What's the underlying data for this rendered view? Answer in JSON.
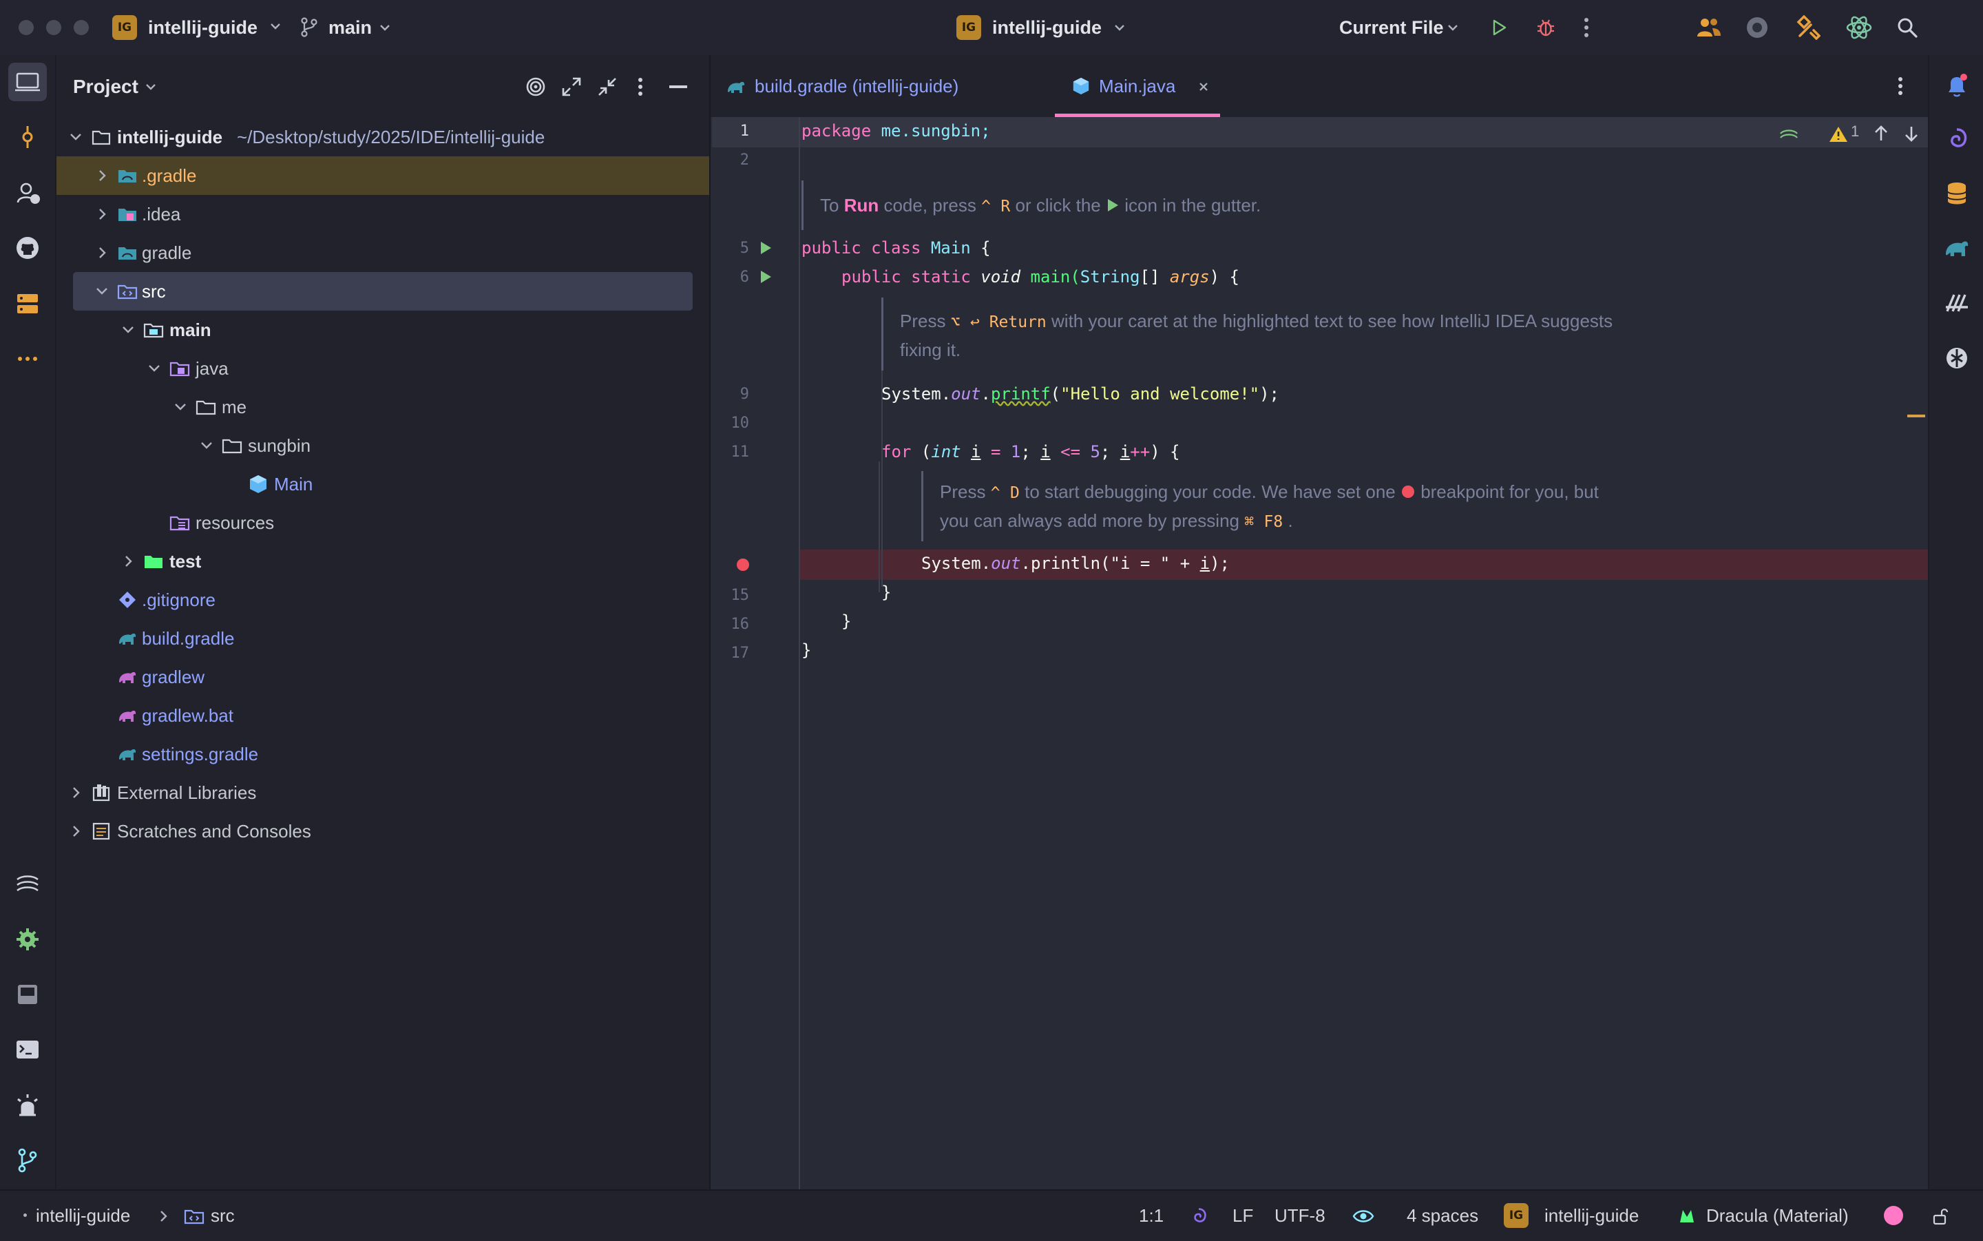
{
  "titlebar": {
    "project_badge": "IG",
    "project_name": "intellij-guide",
    "branch": "main",
    "center_project": "intellij-guide",
    "run_config": "Current File"
  },
  "project_panel": {
    "title": "Project",
    "tree": [
      {
        "label": "intellij-guide",
        "path": "~/Desktop/study/2025/IDE/intellij-guide"
      },
      {
        "label": ".gradle"
      },
      {
        "label": ".idea"
      },
      {
        "label": "gradle"
      },
      {
        "label": "src"
      },
      {
        "label": "main"
      },
      {
        "label": "java"
      },
      {
        "label": "me"
      },
      {
        "label": "sungbin"
      },
      {
        "label": "Main"
      },
      {
        "label": "resources"
      },
      {
        "label": "test"
      },
      {
        "label": ".gitignore"
      },
      {
        "label": "build.gradle"
      },
      {
        "label": "gradlew"
      },
      {
        "label": "gradlew.bat"
      },
      {
        "label": "settings.gradle"
      },
      {
        "label": "External Libraries"
      },
      {
        "label": "Scratches and Consoles"
      }
    ]
  },
  "tabs": [
    {
      "label": "build.gradle (intellij-guide)"
    },
    {
      "label": "Main.java"
    }
  ],
  "editor": {
    "line_numbers": [
      "1",
      "2",
      "5",
      "6",
      "9",
      "10",
      "11",
      "15",
      "16",
      "17"
    ],
    "warning_count": "1",
    "code": {
      "l1_kw": "package",
      "l1_rest": " me.sungbin;",
      "l5_a": "public class ",
      "l5_b": "Main",
      "l5_c": " {",
      "l6_a": "public static ",
      "l6_b": "void ",
      "l6_c": "main(",
      "l6_d": "String",
      "l6_e": "[] ",
      "l6_f": "args",
      "l6_g": ") {",
      "l9_a": "System.",
      "l9_b": "out",
      "l9_c": ".",
      "l9_d": "printf",
      "l9_e": "(",
      "l9_f": "\"Hello and welcome!\"",
      "l9_g": ");",
      "l11_a": "for ",
      "l11_b": "(",
      "l11_c": "int ",
      "l11_d": "i",
      "l11_e": " = ",
      "l11_f": "1",
      "l11_g": "; ",
      "l11_h": "i",
      "l11_i": " <= ",
      "l11_j": "5",
      "l11_k": "; ",
      "l11_l": "i",
      "l11_m": "++",
      "l11_n": ") {",
      "l13_a": "System.",
      "l13_b": "out",
      "l13_c": ".println(\"i = \" + ",
      "l13_d": "i",
      "l13_e": ");",
      "l15": "}",
      "l16": "}",
      "l17": "}"
    },
    "hints": {
      "run_a": "To ",
      "run_b": "Run",
      "run_c": " code, press ",
      "run_kbd1": "^",
      "run_kbd2": "R",
      "run_d": " or click the ",
      "run_e": " icon in the gutter.",
      "fix_a": "Press ",
      "fix_kbd1": "⌥",
      "fix_kbd2": "↩ Return",
      "fix_b": " with your caret at the highlighted text to see how IntelliJ IDEA suggests",
      "fix_c": "fixing it.",
      "dbg_a": "Press ",
      "dbg_kbd1": "^",
      "dbg_kbd2": "D",
      "dbg_b": " to start debugging your code. We have set one ",
      "dbg_c": " breakpoint for you, but",
      "dbg_d": "you can always add more by pressing ",
      "dbg_kbd3": "⌘",
      "dbg_kbd4": "F8",
      "dbg_e": "."
    }
  },
  "statusbar": {
    "crumb_project": "intellij-guide",
    "crumb_folder": "src",
    "position": "1:1",
    "line_sep": "LF",
    "encoding": "UTF-8",
    "indent": "4 spaces",
    "project_badge": "IG",
    "project": "intellij-guide",
    "theme": "Dracula (Material)"
  },
  "colors": {
    "background": "#282a36",
    "accent": "#ff79c6",
    "keyword": "#ff79c6",
    "string": "#f1fa8c",
    "type": "#8be9fd",
    "number": "#bd93f9"
  }
}
